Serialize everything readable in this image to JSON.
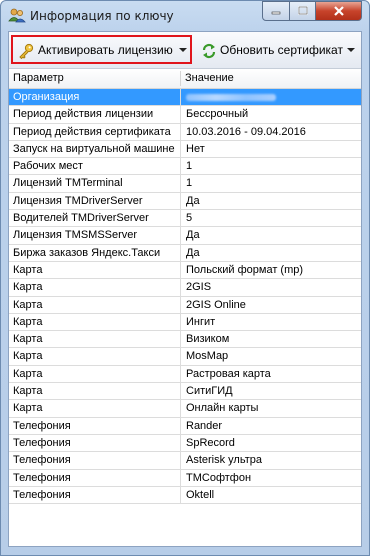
{
  "window": {
    "title": "Информация по ключу"
  },
  "toolbar": {
    "activate_label": "Активировать лицензию",
    "refresh_label": "Обновить сертификат"
  },
  "grid": {
    "headers": {
      "param": "Параметр",
      "value": "Значение"
    },
    "rows": [
      {
        "param": "Организация",
        "value": ""
      },
      {
        "param": "Период действия лицензии",
        "value": "Бессрочный"
      },
      {
        "param": "Период действия сертификата",
        "value": "10.03.2016 - 09.04.2016"
      },
      {
        "param": "Запуск на виртуальной машине",
        "value": "Нет"
      },
      {
        "param": "Рабочих мест",
        "value": "1"
      },
      {
        "param": "Лицензий TMTerminal",
        "value": "1"
      },
      {
        "param": "Лицензия TMDriverServer",
        "value": "Да"
      },
      {
        "param": "Водителей TMDriverServer",
        "value": "5"
      },
      {
        "param": "Лицензия TMSMSServer",
        "value": "Да"
      },
      {
        "param": "Биржа заказов Яндекс.Такси",
        "value": "Да"
      },
      {
        "param": "Карта",
        "value": "Польский формат (mp)"
      },
      {
        "param": "Карта",
        "value": "2GIS"
      },
      {
        "param": "Карта",
        "value": "2GIS Online"
      },
      {
        "param": "Карта",
        "value": "Ингит"
      },
      {
        "param": "Карта",
        "value": "Визиком"
      },
      {
        "param": "Карта",
        "value": "MosMap"
      },
      {
        "param": "Карта",
        "value": "Растровая карта"
      },
      {
        "param": "Карта",
        "value": "СитиГИД"
      },
      {
        "param": "Карта",
        "value": "Онлайн карты"
      },
      {
        "param": "Телефония",
        "value": "Rander"
      },
      {
        "param": "Телефония",
        "value": "SpRecord"
      },
      {
        "param": "Телефония",
        "value": "Asterisk ультра"
      },
      {
        "param": "Телефония",
        "value": "ТМСофтфон"
      },
      {
        "param": "Телефония",
        "value": "Oktell"
      }
    ],
    "selected_index": 0
  },
  "colors": {
    "selection": "#3399ff",
    "highlight_border": "#e0141b"
  }
}
